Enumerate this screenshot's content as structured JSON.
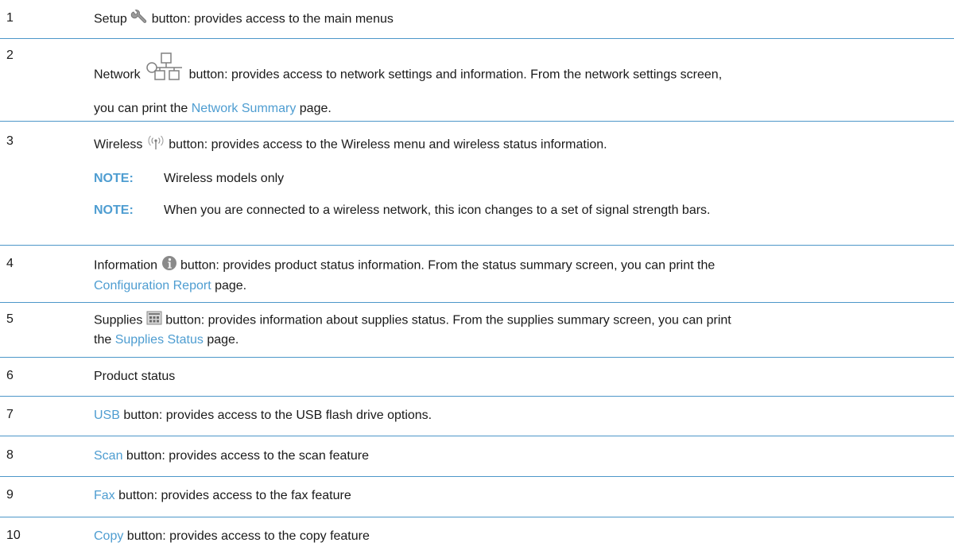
{
  "rows": [
    {
      "num": "1",
      "label": "Setup",
      "text": " button: provides access to the main menus"
    },
    {
      "num": "2",
      "label": "Network",
      "text1": " button: provides access to network settings and information. From the network settings screen,",
      "pre": "you can print the ",
      "link": "Network Summary",
      "post": " page."
    },
    {
      "num": "3",
      "label": "Wireless",
      "text": " button: provides access to the Wireless menu and wireless status information.",
      "notes": [
        {
          "label": "NOTE:",
          "text": "Wireless models only"
        },
        {
          "label": "NOTE:",
          "text": "When you are connected to a wireless network, this icon changes to a set of signal strength bars."
        }
      ]
    },
    {
      "num": "4",
      "label": "Information",
      "text1": " button: provides product status information. From the status summary screen, you can print the",
      "link": "Configuration Report",
      "post": " page."
    },
    {
      "num": "5",
      "label": "Supplies",
      "text1": " button: provides information about supplies status. From the supplies summary screen, you can print",
      "pre": "the ",
      "link": "Supplies Status",
      "post": " page."
    },
    {
      "num": "6",
      "text": "Product status"
    },
    {
      "num": "7",
      "link": "USB",
      "text": " button: provides access to the USB flash drive options."
    },
    {
      "num": "8",
      "link": "Scan",
      "text": " button: provides access to the scan feature"
    },
    {
      "num": "9",
      "link": "Fax",
      "text": " button: provides access to the fax feature"
    },
    {
      "num": "10",
      "link": "Copy",
      "text": " button: provides access to the copy feature"
    }
  ],
  "icons": {
    "setup": "wrench-icon",
    "network": "network-icon",
    "wireless": "wireless-icon",
    "information": "info-icon",
    "supplies": "supplies-icon"
  },
  "colors": {
    "link": "#4e9dd1",
    "rule": "#4d97c9",
    "text": "#1a1a1a"
  }
}
